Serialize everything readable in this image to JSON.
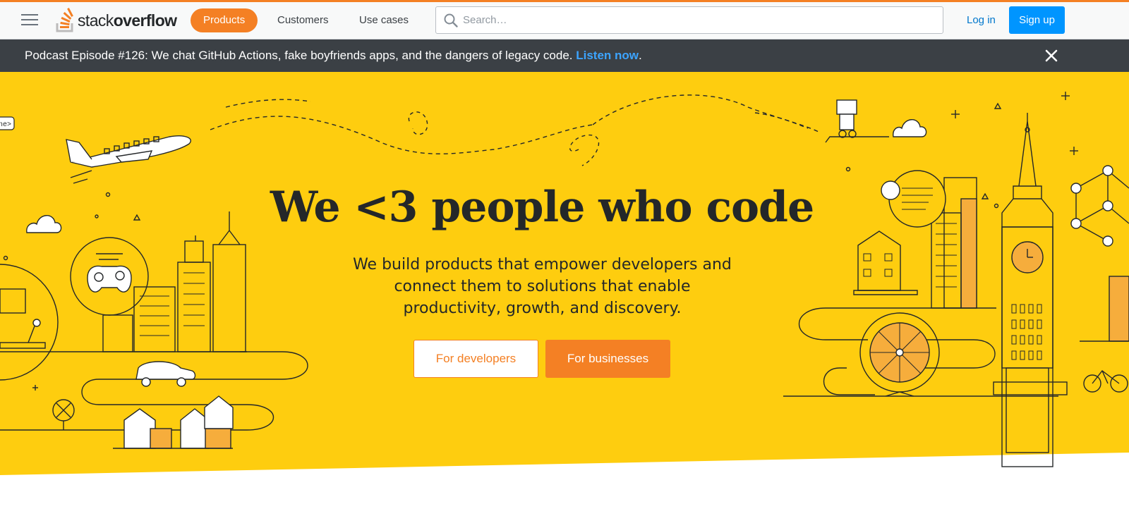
{
  "header": {
    "logo_text_light": "stack",
    "logo_text_bold": "overflow",
    "nav": [
      {
        "label": "Products",
        "active": true
      },
      {
        "label": "Customers",
        "active": false
      },
      {
        "label": "Use cases",
        "active": false
      }
    ],
    "search_placeholder": "Search…",
    "login_label": "Log in",
    "signup_label": "Sign up"
  },
  "notice": {
    "text": "Podcast Episode #126: We chat GitHub Actions, fake boyfriends apps, and the dangers of legacy code. ",
    "link_label": "Listen now",
    "trailing": "."
  },
  "hero": {
    "title": "We <3 people who code",
    "subtitle": "We build products that empower developers and connect them to solutions that enable productivity, growth, and discovery.",
    "developer_button": "For developers",
    "business_button": "For businesses",
    "illustration_fragment_label": "ne>"
  },
  "colors": {
    "brand_orange": "#f48024",
    "hero_yellow": "#fecd0f",
    "link_blue": "#0077cc",
    "signup_blue": "#0095ff",
    "banner_dark": "#3b4045"
  },
  "icons": [
    "hamburger-menu-icon",
    "stack-overflow-logo-icon",
    "search-icon",
    "close-icon"
  ]
}
